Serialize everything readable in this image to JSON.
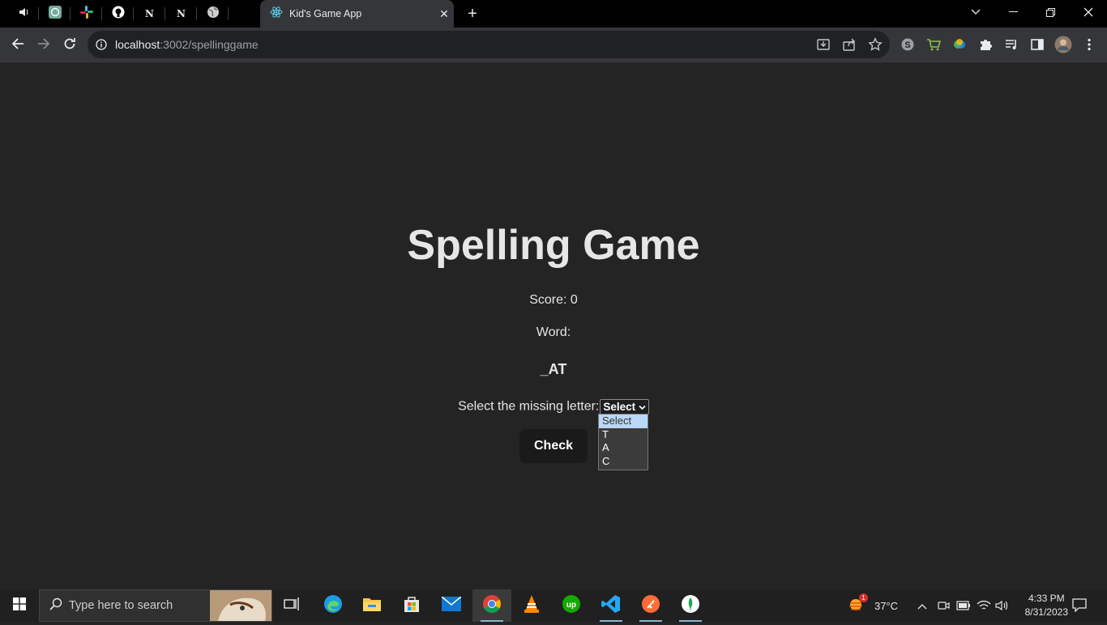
{
  "browser": {
    "active_tab_title": "Kid's Game App",
    "url_host": "localhost",
    "url_path": ":3002/spellinggame"
  },
  "pinned_tabs": [
    {
      "icon": "speaker-icon"
    },
    {
      "icon": "chatgpt-icon"
    },
    {
      "icon": "slack-icon"
    },
    {
      "icon": "github-icon"
    },
    {
      "icon": "notion-icon"
    },
    {
      "icon": "notion-icon"
    },
    {
      "icon": "globe-icon"
    }
  ],
  "game": {
    "title": "Spelling Game",
    "score_label": "Score: 0",
    "word_label": "Word:",
    "word": "_AT",
    "select_label": "Select the missing letter:",
    "selected_value": "Select",
    "options": [
      "Select",
      "T",
      "A",
      "C"
    ],
    "check_button": "Check"
  },
  "taskbar": {
    "search_placeholder": "Type here to search",
    "weather_temp": "37°C",
    "weather_badge": "1",
    "time": "4:33 PM",
    "date": "8/31/2023"
  },
  "colors": {
    "page_bg": "#242424",
    "tab_bg": "#35363a",
    "accent": "#86b6d6"
  }
}
